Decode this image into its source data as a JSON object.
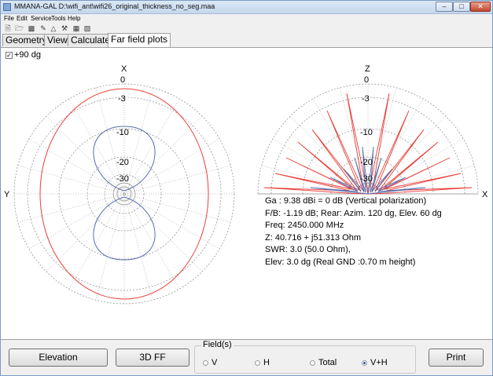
{
  "window": {
    "title": "MMANA-GAL D:\\wifi_ant\\wifi26_original_thickness_no_seg.maa"
  },
  "menu": [
    "File",
    "Edit",
    "Service",
    "Tools",
    "Help"
  ],
  "tabs": [
    "Geometry",
    "View",
    "Calculate",
    "Far field plots"
  ],
  "active_tab": "Far field plots",
  "options": {
    "plus90_checked": true,
    "plus90_label": "+90 dg"
  },
  "plots": {
    "left": {
      "top_axis": "X",
      "side_axis": "Y",
      "ring_labels": [
        "0",
        "-3",
        "-10",
        "-20",
        "-30"
      ]
    },
    "right": {
      "top_axis": "Z",
      "side_axis": "X",
      "ring_labels": [
        "0",
        "-3",
        "-10",
        "-20",
        "-30"
      ]
    },
    "colors": {
      "horizontal_pattern": "#e8403a",
      "vertical_pattern": "#5a6fb0",
      "grid": "#888888"
    }
  },
  "results": {
    "line1": "Ga : 9.38 dBi = 0 dB  (Vertical polarization)",
    "line2": "F/B: -1.19 dB; Rear: Azim. 120 dg,  Elev. 60 dg",
    "line3": "Freq: 2450.000 MHz",
    "line4": "Z: 40.716 + j51.313 Ohm",
    "line5": "SWR: 3.0 (50.0 Ohm),",
    "line6": "Elev: 3.0 dg (Real GND  :0.70 m height)"
  },
  "bottom": {
    "elevation_label": "Elevation",
    "ff3d_label": "3D FF",
    "print_label": "Print",
    "field_group_label": "Field(s)",
    "field_options": [
      "V",
      "H",
      "Total",
      "V+H"
    ],
    "field_selected": "V+H"
  }
}
